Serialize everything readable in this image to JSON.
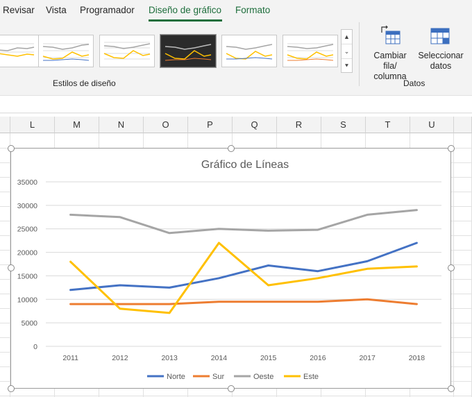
{
  "ribbon_tabs": [
    "Revisar",
    "Vista",
    "Programador",
    "Diseño de gráfico",
    "Formato"
  ],
  "active_tab": "Diseño de gráfico",
  "ribbon": {
    "styles_group_label": "Estilos de diseño",
    "data_group_label": "Datos",
    "switch_row_col_line1": "Cambiar fila/",
    "switch_row_col_line2": "columna",
    "select_data_line1": "Seleccionar",
    "select_data_line2": "datos",
    "gallery_scroll": [
      "▲",
      "⌄",
      "⯆"
    ]
  },
  "columns": [
    "L",
    "M",
    "N",
    "O",
    "P",
    "Q",
    "R",
    "S",
    "T",
    "U"
  ],
  "colors": {
    "accent": "#1e6e3c",
    "norte": "#4472c4",
    "sur": "#ed7d31",
    "oeste": "#a5a5a5",
    "este": "#ffc000"
  },
  "chart_data": {
    "type": "line",
    "title": "Gráfico de Líneas",
    "x": [
      "2011",
      "2012",
      "2013",
      "2014",
      "2015",
      "2016",
      "2017",
      "2018"
    ],
    "yticks": [
      "0",
      "5000",
      "10000",
      "15000",
      "20000",
      "25000",
      "30000",
      "35000"
    ],
    "ylim": [
      0,
      35000
    ],
    "grid": true,
    "legend_position": "bottom",
    "series": [
      {
        "name": "Norte",
        "color": "#4472c4",
        "values": [
          12000,
          13000,
          12500,
          14500,
          17200,
          16000,
          18100,
          22000
        ]
      },
      {
        "name": "Sur",
        "color": "#ed7d31",
        "values": [
          9000,
          9000,
          9000,
          9500,
          9500,
          9500,
          10000,
          9000
        ]
      },
      {
        "name": "Oeste",
        "color": "#a5a5a5",
        "values": [
          28000,
          27500,
          24100,
          25000,
          24600,
          24800,
          28000,
          29000
        ]
      },
      {
        "name": "Este",
        "color": "#ffc000",
        "values": [
          18000,
          8000,
          7100,
          22000,
          13000,
          14500,
          16500,
          17000
        ]
      }
    ]
  }
}
